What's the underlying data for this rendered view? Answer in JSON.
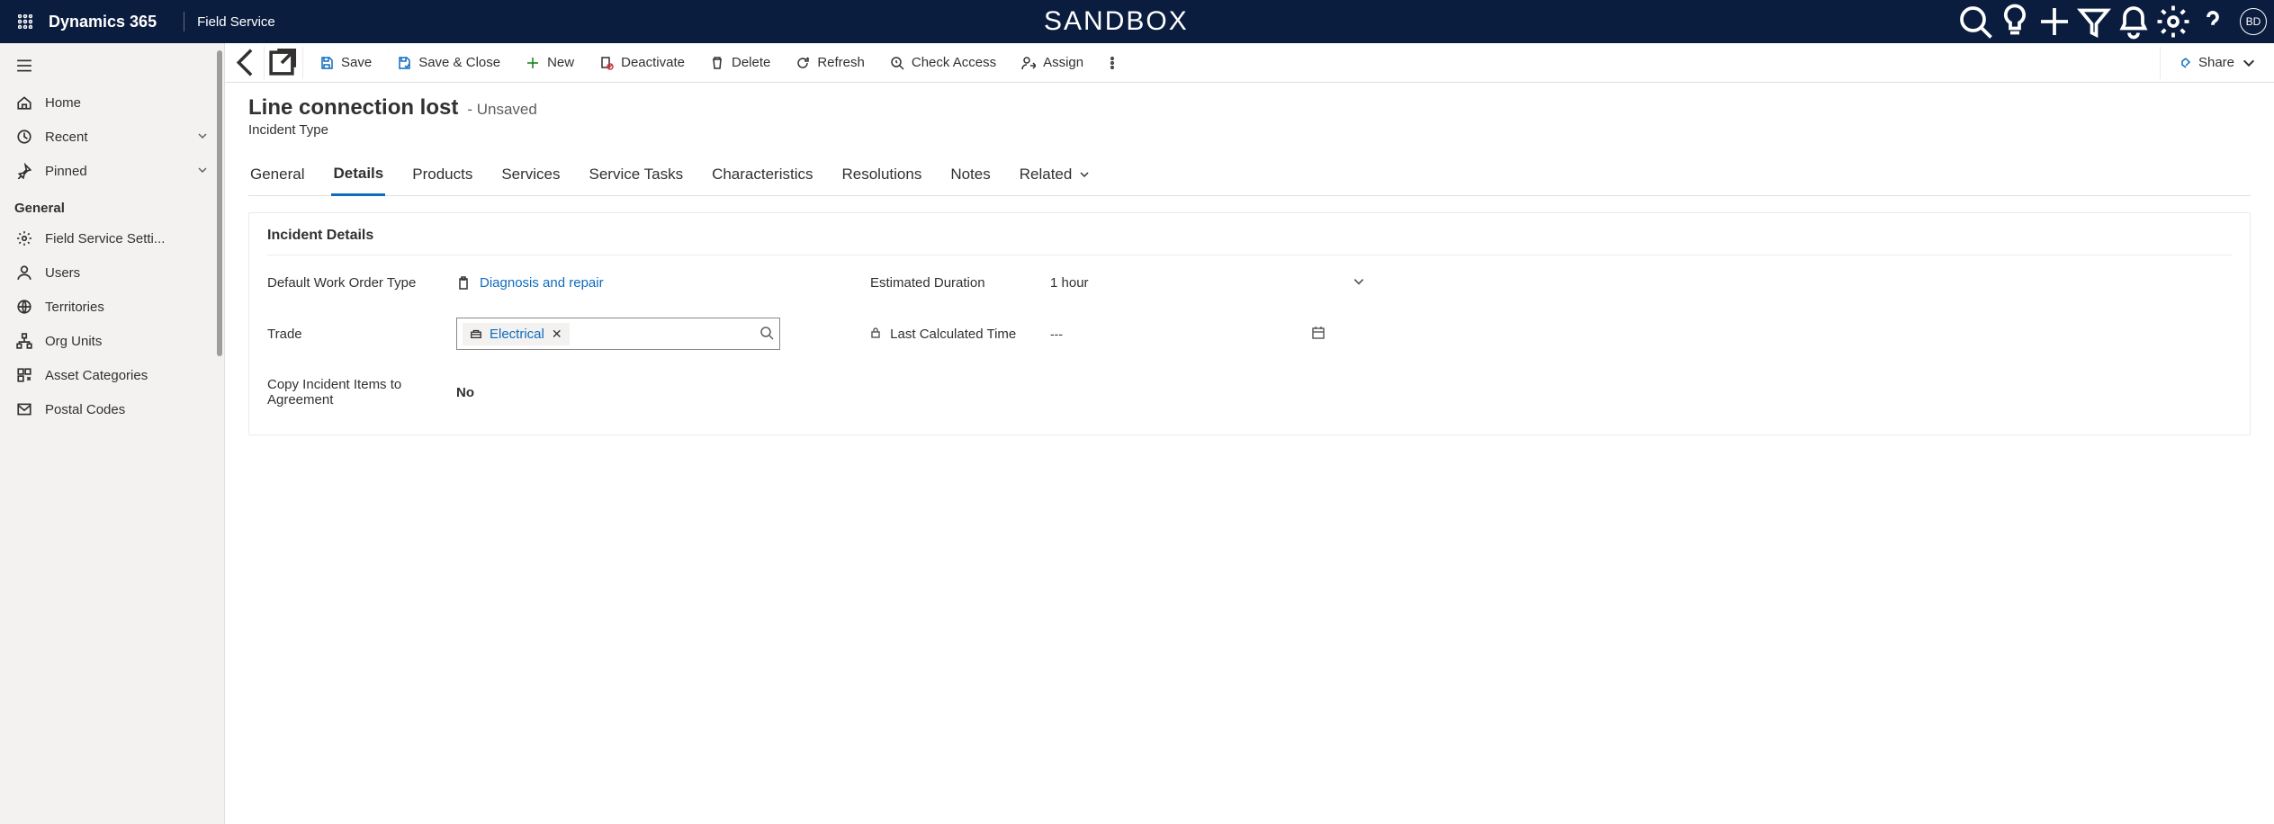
{
  "topbar": {
    "brand": "Dynamics 365",
    "app": "Field Service",
    "center": "SANDBOX",
    "avatar": "BD"
  },
  "sidebar": {
    "home": "Home",
    "recent": "Recent",
    "pinned": "Pinned",
    "section": "General",
    "items": [
      "Field Service Setti...",
      "Users",
      "Territories",
      "Org Units",
      "Asset Categories",
      "Postal Codes"
    ]
  },
  "cmdbar": {
    "save": "Save",
    "saveClose": "Save & Close",
    "new": "New",
    "deactivate": "Deactivate",
    "delete": "Delete",
    "refresh": "Refresh",
    "checkAccess": "Check Access",
    "assign": "Assign",
    "share": "Share"
  },
  "header": {
    "title": "Line connection lost",
    "unsaved": "- Unsaved",
    "entity": "Incident Type"
  },
  "tabs": [
    "General",
    "Details",
    "Products",
    "Services",
    "Service Tasks",
    "Characteristics",
    "Resolutions",
    "Notes",
    "Related"
  ],
  "section": {
    "title": "Incident Details"
  },
  "fields": {
    "wotype": {
      "label": "Default Work Order Type",
      "value": "Diagnosis and repair"
    },
    "trade": {
      "label": "Trade",
      "value": "Electrical"
    },
    "copy": {
      "label": "Copy Incident Items to Agreement",
      "value": "No"
    },
    "estDuration": {
      "label": "Estimated Duration",
      "value": "1 hour"
    },
    "lastCalc": {
      "label": "Last Calculated Time",
      "value": "---"
    }
  }
}
